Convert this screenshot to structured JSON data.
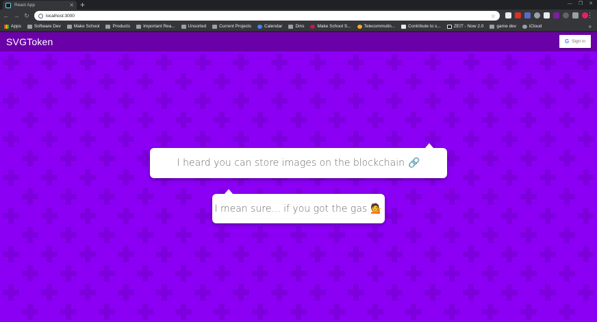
{
  "browser": {
    "tab_title": "React App",
    "url": "localhost:3000",
    "bookmarks": [
      "Apps",
      "Software Dev",
      "Make School",
      "Products",
      "Important Rea...",
      "Unsorted",
      "Current Projects",
      "Calendar",
      "Dins",
      "Make School S...",
      "Telecommutin...",
      "Contribute to s...",
      "ZEIT - Now 2.0",
      "game dev",
      "iCloud"
    ]
  },
  "app": {
    "brand": "SVGToken",
    "signin_label": "Sign in"
  },
  "bubbles": {
    "first": {
      "text": "I heard you can store images on the blockchain",
      "emoji": "🔗"
    },
    "second": {
      "text": "I mean sure... if you got the gas",
      "emoji": "💁"
    }
  },
  "colors": {
    "navbar": "#6a00a8",
    "background": "#8b00f5",
    "pattern": "#7d00dc"
  }
}
